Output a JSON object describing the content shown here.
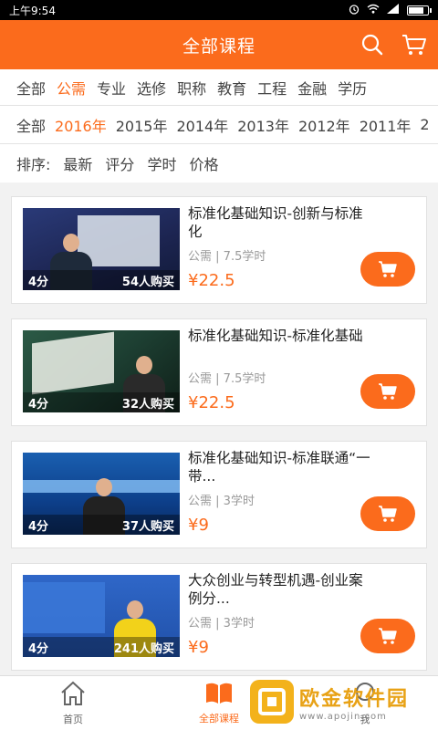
{
  "status_bar": {
    "time": "上午9:54",
    "icons": [
      "alarm-icon",
      "wifi-icon",
      "signal-icon",
      "battery-icon"
    ],
    "battery_level": 0.85
  },
  "header": {
    "title": "全部课程",
    "icons": [
      "search-icon",
      "cart-icon"
    ]
  },
  "filters": {
    "categories": [
      {
        "label": "全部",
        "active": false
      },
      {
        "label": "公需",
        "active": true
      },
      {
        "label": "专业",
        "active": false
      },
      {
        "label": "选修",
        "active": false
      },
      {
        "label": "职称",
        "active": false
      },
      {
        "label": "教育",
        "active": false
      },
      {
        "label": "工程",
        "active": false
      },
      {
        "label": "金融",
        "active": false
      },
      {
        "label": "学历",
        "active": false
      }
    ],
    "years": [
      {
        "label": "全部",
        "active": false
      },
      {
        "label": "2016年",
        "active": true
      },
      {
        "label": "2015年",
        "active": false
      },
      {
        "label": "2014年",
        "active": false
      },
      {
        "label": "2013年",
        "active": false
      },
      {
        "label": "2012年",
        "active": false
      },
      {
        "label": "2011年",
        "active": false
      },
      {
        "label": "2",
        "active": false
      }
    ],
    "sort": {
      "label": "排序:",
      "options": [
        "最新",
        "评分",
        "学时",
        "价格"
      ]
    }
  },
  "courses": [
    {
      "title": "标准化基础知识-创新与标准化",
      "category": "公需",
      "hours": "7.5学时",
      "price": "¥22.5",
      "rating": "4分",
      "buyers": "54人购买"
    },
    {
      "title": "标准化基础知识-标准化基础",
      "category": "公需",
      "hours": "7.5学时",
      "price": "¥22.5",
      "rating": "4分",
      "buyers": "32人购买"
    },
    {
      "title": "标准化基础知识-标准联通“一带...",
      "category": "公需",
      "hours": "3学时",
      "price": "¥9",
      "rating": "4分",
      "buyers": "37人购买"
    },
    {
      "title": "大众创业与转型机遇-创业案例分...",
      "category": "公需",
      "hours": "3学时",
      "price": "¥9",
      "rating": "4分",
      "buyers": "241人购买"
    }
  ],
  "tabbar": [
    {
      "label": "首页",
      "icon": "home-icon",
      "active": false
    },
    {
      "label": "全部课程",
      "icon": "book-icon",
      "active": true
    },
    {
      "label": "我",
      "icon": "user-icon",
      "active": false
    }
  ],
  "watermark": {
    "main": "欧金软件园",
    "url": "www.apojin.com"
  },
  "colors": {
    "accent": "#fb6b1c",
    "background": "#f2f2f2"
  }
}
